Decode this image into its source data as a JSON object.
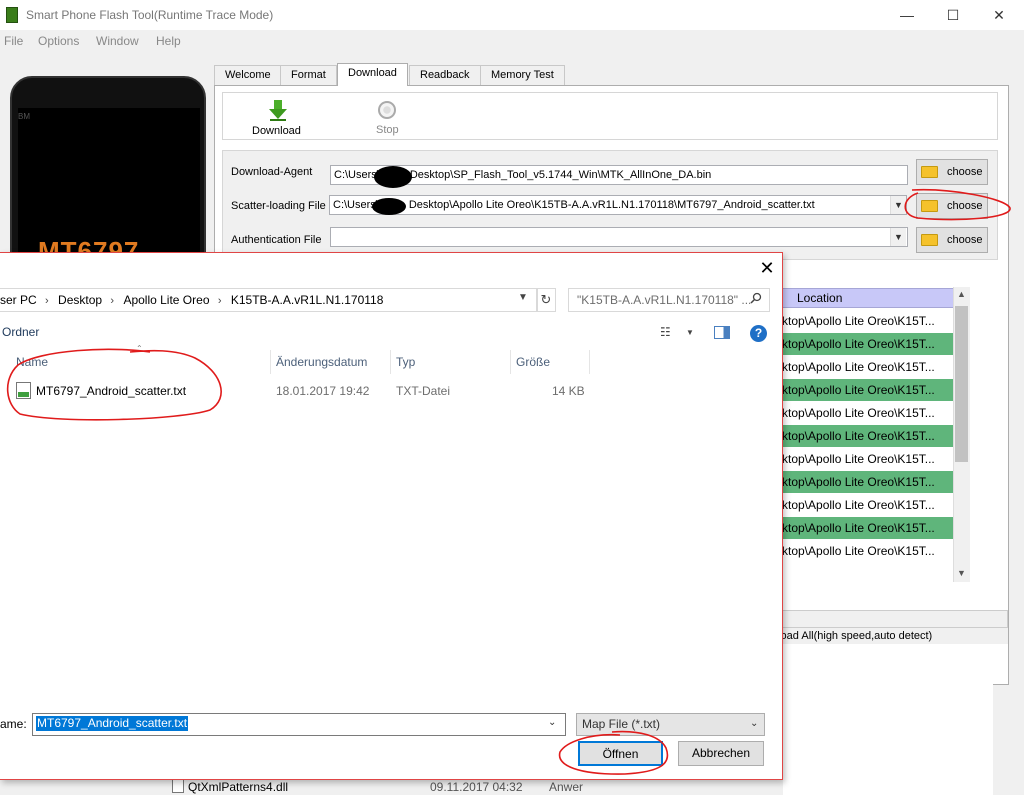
{
  "window": {
    "title": "Smart Phone Flash Tool(Runtime Trace Mode)",
    "controls": {
      "minimize": "—",
      "maximize": "☐",
      "close": "✕"
    }
  },
  "menu": [
    "File",
    "Options",
    "Window",
    "Help"
  ],
  "phone": {
    "model_label": "MT6797",
    "brand_mark": "BM"
  },
  "tabs": [
    "Welcome",
    "Format",
    "Download",
    "Readback",
    "Memory Test"
  ],
  "active_tab": "Download",
  "toolbar": {
    "download_label": "Download",
    "stop_label": "Stop"
  },
  "files": {
    "download_agent": {
      "label": "Download-Agent",
      "value_prefix": "C:\\Users\\",
      "value_suffix": "Desktop\\SP_Flash_Tool_v5.1744_Win\\MTK_AllInOne_DA.bin"
    },
    "scatter": {
      "label": "Scatter-loading File",
      "value_prefix": "C:\\Users\\",
      "value_suffix": "Desktop\\Apollo Lite Oreo\\K15TB-A.A.vR1L.N1.170118\\MT6797_Android_scatter.txt"
    },
    "auth": {
      "label": "Authentication File",
      "value": ""
    },
    "choose_label": "choose"
  },
  "location_table": {
    "header": "Location",
    "rows": [
      "sktop\\Apollo Lite Oreo\\K15T...",
      "sktop\\Apollo Lite Oreo\\K15T...",
      "sktop\\Apollo Lite Oreo\\K15T...",
      "sktop\\Apollo Lite Oreo\\K15T...",
      "sktop\\Apollo Lite Oreo\\K15T...",
      "sktop\\Apollo Lite Oreo\\K15T...",
      "sktop\\Apollo Lite Oreo\\K15T...",
      "sktop\\Apollo Lite Oreo\\K15T...",
      "sktop\\Apollo Lite Oreo\\K15T...",
      "sktop\\Apollo Lite Oreo\\K15T...",
      "sktop\\Apollo Lite Oreo\\K15T..."
    ]
  },
  "status_text": "nload All(high speed,auto detect)",
  "background_row": {
    "name": "QtXmlPatterns4.dll",
    "date": "09.11.2017 04:32",
    "type": "Anwer"
  },
  "dialog": {
    "close": "✕",
    "breadcrumb": [
      "ser PC",
      "Desktop",
      "Apollo Lite Oreo",
      "K15TB-A.A.vR1L.N1.170118"
    ],
    "search_placeholder": "\"K15TB-A.A.vR1L.N1.170118\" ...",
    "new_folder": "Ordner",
    "columns": {
      "name": "Name",
      "date": "Änderungsdatum",
      "type": "Typ",
      "size": "Größe"
    },
    "files": [
      {
        "name": "MT6797_Android_scatter.txt",
        "date": "18.01.2017 19:42",
        "type": "TXT-Datei",
        "size": "14 KB"
      }
    ],
    "filename_label": "ame:",
    "filename_value": "MT6797_Android_scatter.txt",
    "filetype": "Map File (*.txt)",
    "open_label": "Öffnen",
    "cancel_label": "Abbrechen"
  },
  "colors": {
    "green_row": "#5fb57b",
    "header_row": "#c8c8f8",
    "annotation": "#e01b1b",
    "accent": "#0078d7"
  }
}
